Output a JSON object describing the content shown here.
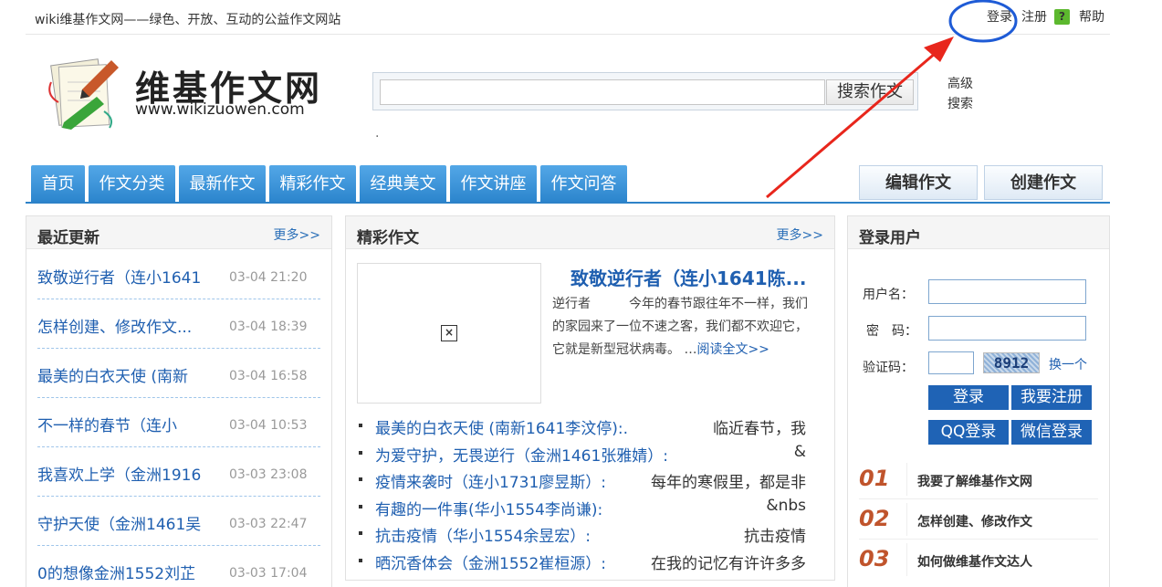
{
  "topbar": {
    "slogan": "wiki维基作文网——绿色、开放、互动的公益作文网站",
    "login": "登录",
    "register": "注册",
    "help_icon": "?",
    "help": "帮助"
  },
  "logo": {
    "name": "维基作文网",
    "url": "www.wikizuowen.com"
  },
  "search": {
    "value": "",
    "button": "搜索作文",
    "advanced": "高级搜索",
    "dot": "."
  },
  "nav": {
    "tabs": [
      "首页",
      "作文分类",
      "最新作文",
      "精彩作文",
      "经典美文",
      "作文讲座",
      "作文问答"
    ],
    "edit": "编辑作文",
    "create": "创建作文"
  },
  "recent": {
    "title": "最近更新",
    "more": "更多>>",
    "items": [
      {
        "title": "致敬逆行者（连小1641",
        "time": "03-04 21:20"
      },
      {
        "title": "怎样创建、修改作文...",
        "time": "03-04 18:39"
      },
      {
        "title": "最美的白衣天使 (南新",
        "time": "03-04 16:58"
      },
      {
        "title": "不一样的春节（连小",
        "time": "03-04 10:53"
      },
      {
        "title": "我喜欢上学（金洲1916",
        "time": "03-03 23:08"
      },
      {
        "title": "守护天使（金洲1461吴",
        "time": "03-03 22:47"
      },
      {
        "title": "0的想像金洲1552刘芷",
        "time": "03-03 17:04"
      }
    ]
  },
  "featured": {
    "title": "精彩作文",
    "more": "更多>>",
    "main_title": "致敬逆行者（连小1641陈...",
    "excerpt": "逆行者　　　今年的春节跟往年不一样，我们的家园来了一位不速之客，我们都不欢迎它，它就是新型冠状病毒。 …",
    "read_more": "阅读全文>>",
    "list": [
      {
        "title": "最美的白衣天使 (南新1641李汶停):.",
        "excerpt": "临近春节，我"
      },
      {
        "title": "为爱守护，无畏逆行（金洲1461张雅婧）:",
        "excerpt": "&"
      },
      {
        "title": "疫情来袭时（连小1731廖昱斯）:",
        "excerpt": "每年的寒假里，都是非"
      },
      {
        "title": "有趣的一件事(华小1554李尚谦):",
        "excerpt": "&nbs"
      },
      {
        "title": "抗击疫情（华小1554余昱宏）:",
        "excerpt": "抗击疫情"
      },
      {
        "title": "晒沉香体会（金洲1552崔桓源）:",
        "excerpt": "在我的记忆有许许多多"
      }
    ]
  },
  "login": {
    "title": "登录用户",
    "username_label": "用户名：",
    "password_label": "密　码：",
    "captcha_label": "验证码：",
    "captcha_text": "8912",
    "change": "换一个",
    "login_btn": "登录",
    "register_btn": "我要注册",
    "qq_btn": "QQ登录",
    "wechat_btn": "微信登录"
  },
  "steps": [
    {
      "n": "01",
      "text": "我要了解维基作文网"
    },
    {
      "n": "02",
      "text": "怎样创建、修改作文"
    },
    {
      "n": "03",
      "text": "如何做维基作文达人"
    }
  ],
  "colors": {
    "nav_blue": "#2c85cd",
    "link_blue": "#1f5fb0",
    "annotation_red": "#e8261c",
    "annotation_circle": "#1e5bd6"
  }
}
